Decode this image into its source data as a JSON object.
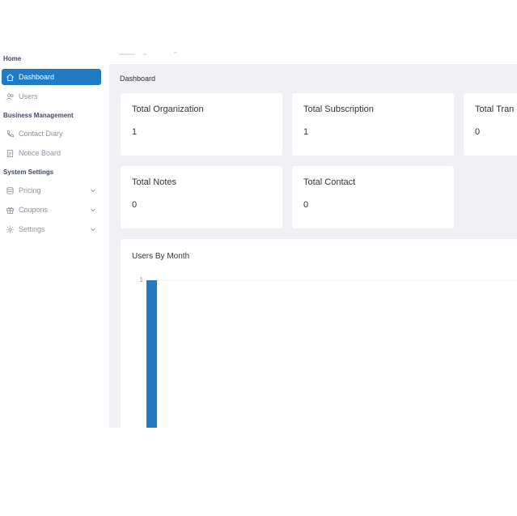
{
  "sidebar": {
    "sections": {
      "home": "Home",
      "business": "Business Management",
      "system": "System Settings"
    },
    "items": [
      {
        "label": "Dashboard",
        "icon": "home-icon",
        "active": true
      },
      {
        "label": "Users",
        "icon": "users-icon"
      },
      {
        "label": "Contact Diary",
        "icon": "phone-icon"
      },
      {
        "label": "Notice Board",
        "icon": "document-icon"
      },
      {
        "label": "Pricing",
        "icon": "database-icon",
        "expandable": true
      },
      {
        "label": "Coupons",
        "icon": "gift-icon",
        "expandable": true
      },
      {
        "label": "Settings",
        "icon": "gear-icon",
        "expandable": true
      }
    ],
    "accent_color": "#1e7bc4"
  },
  "breadcrumb": "Dashboard",
  "stats": [
    {
      "title": "Total Organization",
      "value": "1"
    },
    {
      "title": "Total Subscription",
      "value": "1"
    },
    {
      "title": "Total Tran",
      "value": "0"
    },
    {
      "title": "Total Notes",
      "value": "0"
    },
    {
      "title": "Total Contact",
      "value": "0"
    }
  ],
  "chart_data": {
    "type": "bar",
    "title": "Users By Month",
    "categories": [
      ""
    ],
    "values": [
      1
    ],
    "yticks": [
      "1"
    ],
    "ylim": [
      0,
      1
    ],
    "bar_color": "#1e7bc4"
  }
}
